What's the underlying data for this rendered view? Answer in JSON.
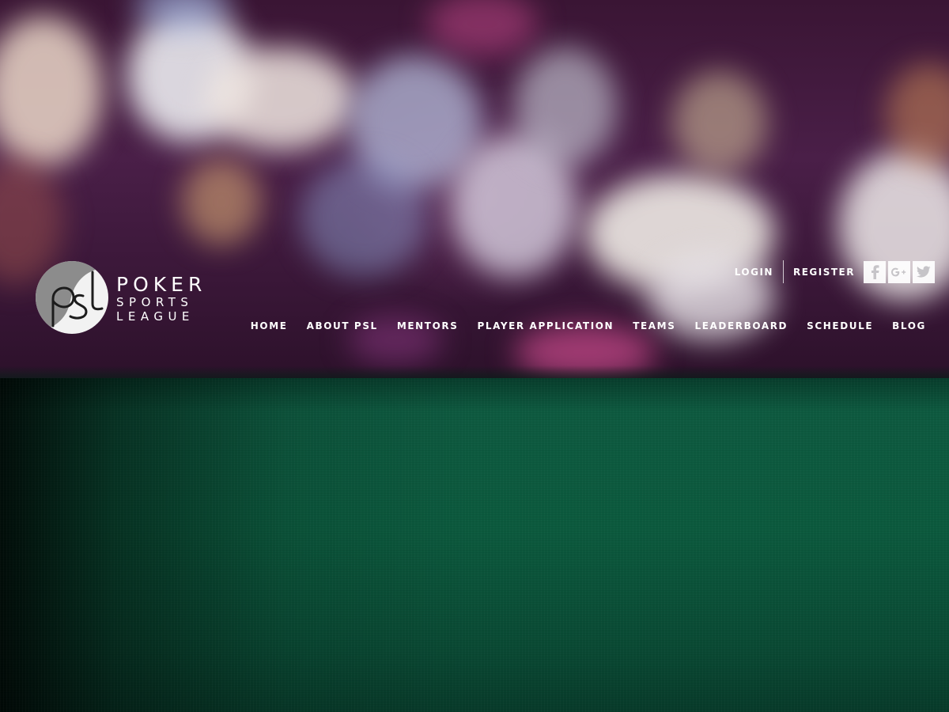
{
  "brand": {
    "line1": "POKER",
    "line2": "SPORTS",
    "line3": "LEAGUE",
    "mark_text": "psl",
    "colors": {
      "text": "#ffffff",
      "mark_light": "#f2f2f2",
      "mark_dark": "#8c8c8c"
    }
  },
  "utility": {
    "login": "LOGIN",
    "register": "REGISTER",
    "socials": [
      {
        "name": "facebook",
        "icon": "facebook-icon"
      },
      {
        "name": "google-plus",
        "icon": "google-plus-icon"
      },
      {
        "name": "twitter",
        "icon": "twitter-icon"
      }
    ]
  },
  "nav": {
    "items": [
      {
        "label": "HOME"
      },
      {
        "label": "ABOUT PSL"
      },
      {
        "label": "MENTORS"
      },
      {
        "label": "PLAYER APPLICATION"
      },
      {
        "label": "TEAMS"
      },
      {
        "label": "LEADERBOARD"
      },
      {
        "label": "SCHEDULE"
      },
      {
        "label": "BLOG"
      }
    ]
  },
  "theme": {
    "felt_green": "#0c5a3e",
    "backdrop_purple": "#3a1534"
  }
}
